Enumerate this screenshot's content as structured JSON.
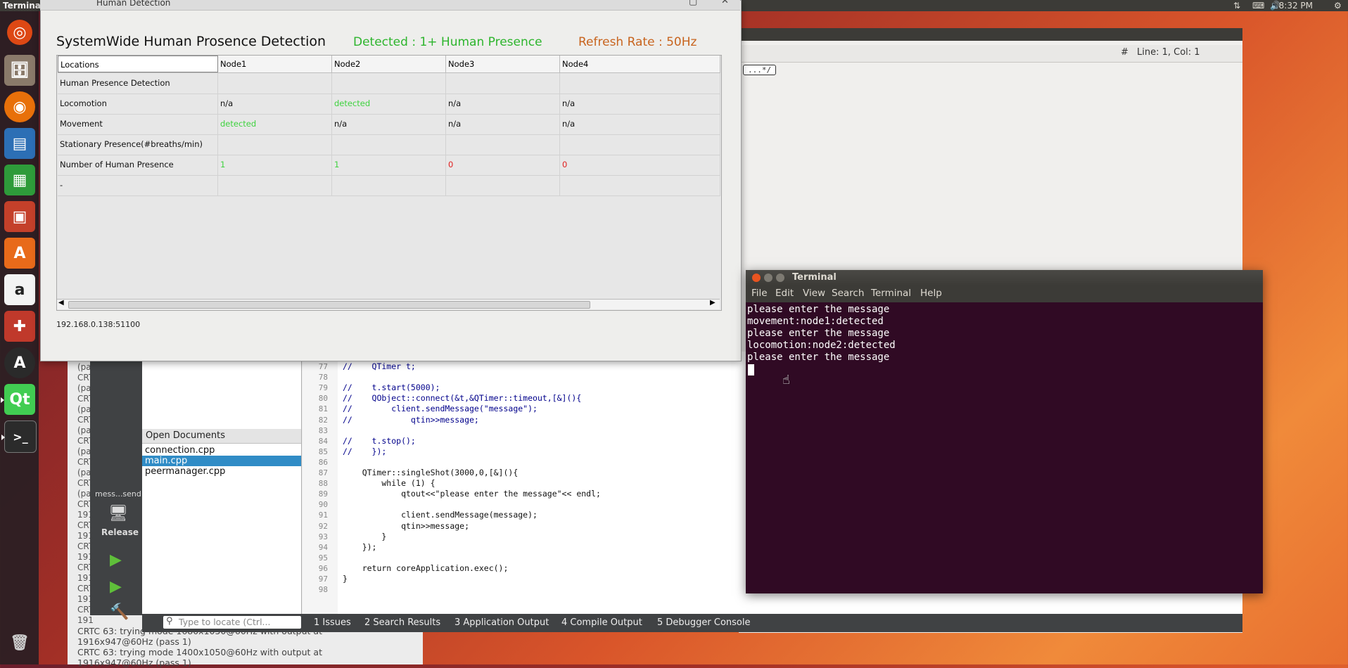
{
  "top_panel": {
    "app_title": "Termina",
    "clock": "8:32 PM"
  },
  "launcher": {
    "icons": [
      "ubuntu-dash-icon",
      "files-icon",
      "firefox-icon",
      "writer-icon",
      "calc-icon",
      "impress-icon",
      "software-center-icon",
      "amazon-icon",
      "settings-icon",
      "updater-icon",
      "qt-creator-icon",
      "terminal-icon",
      "trash-icon"
    ]
  },
  "editor_back": {
    "cursor_position": "Line: 1, Col: 1",
    "hash_label": "#",
    "snippet": "...*/"
  },
  "hd_window": {
    "title": "Human Detection",
    "heading": "SystemWide Human Prosence Detection",
    "detected": "Detected :  1+ Human Presence",
    "refresh": "Refresh Rate : 50Hz",
    "address": "192.168.0.138:51100",
    "colors": {
      "detected": "#2db52d",
      "refresh": "#c8641e",
      "green_value": "#3fd23f",
      "red_value": "#e02020"
    },
    "table": {
      "headers": [
        "Locations",
        "Node1",
        "Node2",
        "Node3",
        "Node4"
      ],
      "rows": [
        {
          "label": "Human Presence Detection",
          "cells": [
            "",
            "",
            "",
            ""
          ]
        },
        {
          "label": "Locomotion",
          "cells": [
            "n/a",
            "detected",
            "n/a",
            "n/a"
          ]
        },
        {
          "label": "Movement",
          "cells": [
            "detected",
            "n/a",
            "n/a",
            "n/a"
          ]
        },
        {
          "label": "Stationary Presence(#breaths/min)",
          "cells": [
            "",
            "",
            "",
            ""
          ]
        },
        {
          "label": "Number of Human Presence",
          "cells": [
            "1",
            "1",
            "0",
            "0"
          ]
        },
        {
          "label": "-",
          "cells": [
            "",
            "",
            "",
            ""
          ]
        }
      ]
    }
  },
  "qt_creator": {
    "mode_label": "mess...send",
    "release_label": "Release",
    "open_documents_title": "Open Documents",
    "documents": [
      "connection.cpp",
      "main.cpp",
      "peermanager.cpp"
    ],
    "selected_document": "main.cpp",
    "locate_placeholder": "Type to locate (Ctrl...",
    "bottom_tabs": [
      "1  Issues",
      "2  Search Results",
      "3  Application Output",
      "4  Compile Output",
      "5  Debugger Console"
    ],
    "log_lines": [
      "CRT",
      "(pa",
      "CRT",
      "(pa",
      "CRT",
      "(pa",
      "CRT",
      "(pa",
      "CRT",
      "(pa",
      "CRT",
      "(pa",
      "CRT",
      "(pa",
      "CRT",
      "191",
      "CRT",
      "191",
      "CRT",
      "191",
      "CRT",
      "191",
      "CRT",
      "191",
      "CRT",
      "191"
    ],
    "log_bottom": [
      "CRTC 63: trying mode 1680x1050@60Hz with output at",
      "1916x947@60Hz (pass 1)",
      "CRTC 63: trying mode 1400x1050@60Hz with output at",
      "1916x947@60Hz (pass 1)"
    ],
    "code_lines": [
      {
        "n": "77",
        "t": "//    QTimer t;"
      },
      {
        "n": "78",
        "t": ""
      },
      {
        "n": "79",
        "t": "//    t.start(5000);"
      },
      {
        "n": "80",
        "t": "//    QObject::connect(&t,&QTimer::timeout,[&](){"
      },
      {
        "n": "81",
        "t": "//        client.sendMessage(\"message\");"
      },
      {
        "n": "82",
        "t": "//            qtin>>message;"
      },
      {
        "n": "83",
        "t": ""
      },
      {
        "n": "84",
        "t": "//    t.stop();"
      },
      {
        "n": "85",
        "t": "//    });"
      },
      {
        "n": "86",
        "t": ""
      },
      {
        "n": "87",
        "t": "    QTimer::singleShot(3000,0,[&](){"
      },
      {
        "n": "88",
        "t": "        while (1) {"
      },
      {
        "n": "89",
        "t": "            qtout<<\"please enter the message\"<< endl;"
      },
      {
        "n": "90",
        "t": ""
      },
      {
        "n": "91",
        "t": "            client.sendMessage(message);"
      },
      {
        "n": "92",
        "t": "            qtin>>message;"
      },
      {
        "n": "93",
        "t": "        }"
      },
      {
        "n": "94",
        "t": "    });"
      },
      {
        "n": "95",
        "t": ""
      },
      {
        "n": "96",
        "t": "    return coreApplication.exec();"
      },
      {
        "n": "97",
        "t": "}"
      },
      {
        "n": "98",
        "t": ""
      }
    ]
  },
  "terminal": {
    "title": "Terminal",
    "menu": [
      "File",
      "Edit",
      "View",
      "Search",
      "Terminal",
      "Help"
    ],
    "lines": [
      "please enter the message",
      "movement:node1:detected",
      "please enter the message",
      "locomotion:node2:detected",
      "please enter the message"
    ]
  }
}
